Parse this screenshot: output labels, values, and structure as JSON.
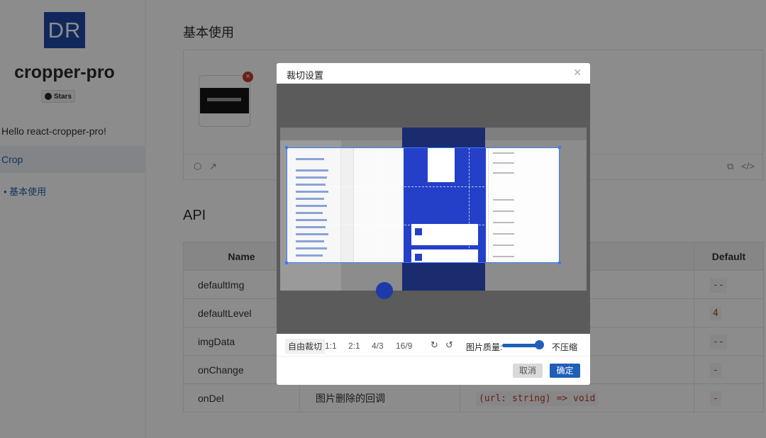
{
  "sidebar": {
    "logo_text": "DR",
    "app_title": "cropper-pro",
    "stars_label": "Stars",
    "hello_text": "Hello react-cropper-pro!",
    "nav": [
      {
        "label": "Crop"
      },
      {
        "label": "• 基本使用"
      }
    ]
  },
  "main": {
    "section_title": "基本使用",
    "api_title": "API",
    "table": {
      "headers": [
        "Name",
        "",
        "",
        "Default"
      ],
      "rows": [
        {
          "name": "defaultImg",
          "desc": "",
          "type": "",
          "default": "--"
        },
        {
          "name": "defaultLevel",
          "desc": "",
          "type": "",
          "default": "4"
        },
        {
          "name": "imgData",
          "desc": "",
          "type": "",
          "default": "--"
        },
        {
          "name": "onChange",
          "desc": "",
          "type": "",
          "default": "-"
        },
        {
          "name": "onDel",
          "desc": "图片删除的回调",
          "type": "(url: string) => void",
          "default": "-"
        }
      ]
    }
  },
  "modal": {
    "title": "裁切设置",
    "toolbar": {
      "free_crop": "自由裁切",
      "ratios": [
        "1:1",
        "2:1",
        "4/3",
        "16/9"
      ],
      "quality_label": "图片质量:",
      "quality_value": "不压缩"
    },
    "cancel_label": "取消",
    "ok_label": "确定"
  },
  "colors": {
    "accent": "#1f5fb7",
    "logo_bg": "#1f4aa8",
    "code_text": "#c0392b"
  }
}
